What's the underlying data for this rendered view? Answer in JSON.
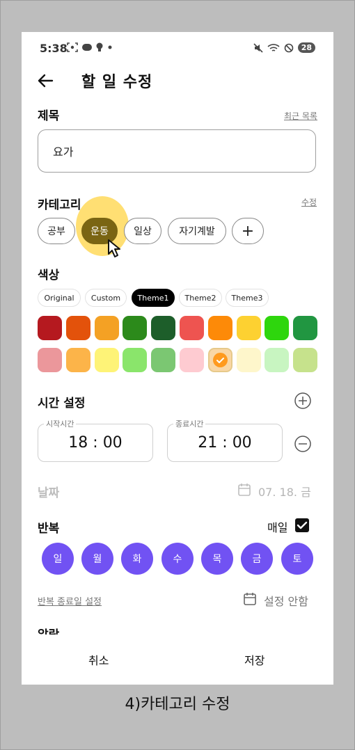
{
  "status_bar": {
    "time": "5:38",
    "battery": "28",
    "left_icons": [
      "screenshot-icon",
      "app-badge-icon",
      "lightbulb-icon",
      "dot-icon"
    ],
    "right_icons": [
      "mute-icon",
      "wifi-icon",
      "do-not-disturb-icon"
    ]
  },
  "app_bar": {
    "title": "할 일 수정",
    "back_icon": "arrow-left-icon"
  },
  "title_section": {
    "label": "제목",
    "recent_link": "최근 목록",
    "value": "요가"
  },
  "category_section": {
    "label": "카테고리",
    "edit_link": "수정",
    "chips": [
      {
        "label": "공부",
        "selected": false
      },
      {
        "label": "운동",
        "selected": true
      },
      {
        "label": "일상",
        "selected": false
      },
      {
        "label": "자기계발",
        "selected": false
      }
    ],
    "add_label": "+"
  },
  "color_section": {
    "label": "색상",
    "themes": [
      "Original",
      "Custom",
      "Theme1",
      "Theme2",
      "Theme3"
    ],
    "active_theme": "Theme1",
    "swatches": [
      "#b5191f",
      "#e3520b",
      "#f4a124",
      "#2c8a1b",
      "#1d5e2a",
      "#ee5450",
      "#fd8a08",
      "#fdd131",
      "#2ed60d",
      "#219641",
      "#eb979b",
      "#fcb449",
      "#fef377",
      "#8ae56b",
      "#7bc772",
      "#fecbd1",
      "#f9d7a6",
      "#fef6cb",
      "#c8f5c1",
      "#c6e28c"
    ],
    "selected_swatch_index": 16
  },
  "time_section": {
    "label": "시간 설정",
    "start_caption": "시작시간",
    "start_time": "18 : 00",
    "end_caption": "종료시간",
    "end_time": "21 : 00"
  },
  "date_section": {
    "label": "날짜",
    "value": "07. 18. 금"
  },
  "repeat_section": {
    "label": "반복",
    "daily_label": "매일",
    "daily_checked": true,
    "days": [
      "일",
      "월",
      "화",
      "수",
      "목",
      "금",
      "토"
    ],
    "end_date_link": "반복 종료일 설정",
    "end_date_value": "설정 안함"
  },
  "peek_label": "알람",
  "bottom_bar": {
    "cancel_label": "취소",
    "save_label": "저장"
  },
  "caption": "4)카테고리 수정"
}
